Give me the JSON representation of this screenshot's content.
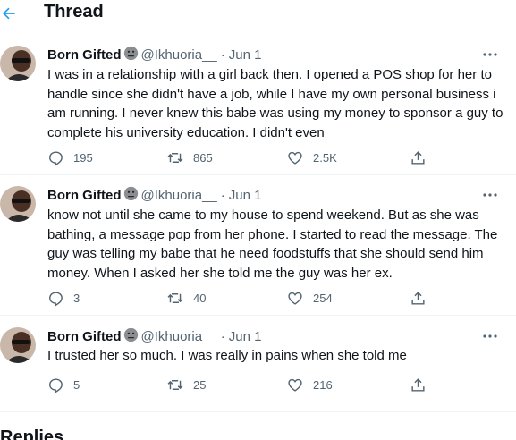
{
  "header": {
    "title": "Thread",
    "back_icon": "arrow-left-icon",
    "accent": "#1d9bf0"
  },
  "tweets": [
    {
      "author": "Born Gifted",
      "emoji": "neutral-face-emoji",
      "handle": "@Ikhuoria__",
      "separator": "·",
      "date": "Jun 1",
      "lines": [
        "I was in a relationship with a girl back  then. I opened a POS shop for her to",
        "handle since she didn't have a job, while I have my own personal business i",
        "am running. I never knew this babe was using my money to sponsor a guy to",
        "complete his university education.  I didn't even"
      ],
      "replies": "195",
      "retweets": "865",
      "likes": "2.5K"
    },
    {
      "author": "Born Gifted",
      "emoji": "neutral-face-emoji",
      "handle": "@Ikhuoria__",
      "separator": "·",
      "date": "Jun 1",
      "lines": [
        "know not until she came to my house to spend weekend. But as she was",
        "bathing, a message pop from her phone. I started to read the message. The",
        "guy was telling my babe that he need foodstuffs that she should send him",
        "money. When I asked her she told me the guy was her ex."
      ],
      "replies": "3",
      "retweets": "40",
      "likes": "254"
    },
    {
      "author": "Born Gifted",
      "emoji": "neutral-face-emoji",
      "handle": "@Ikhuoria__",
      "separator": "·",
      "date": "Jun 1",
      "lines": [
        "I trusted her so much. I was really in pains when she told me"
      ],
      "replies": "5",
      "retweets": "25",
      "likes": "216"
    }
  ],
  "replies_heading": "Replies",
  "icons": {
    "more": "more-horizontal-icon",
    "reply": "reply-icon",
    "retweet": "retweet-icon",
    "like": "heart-icon",
    "share": "share-icon"
  }
}
